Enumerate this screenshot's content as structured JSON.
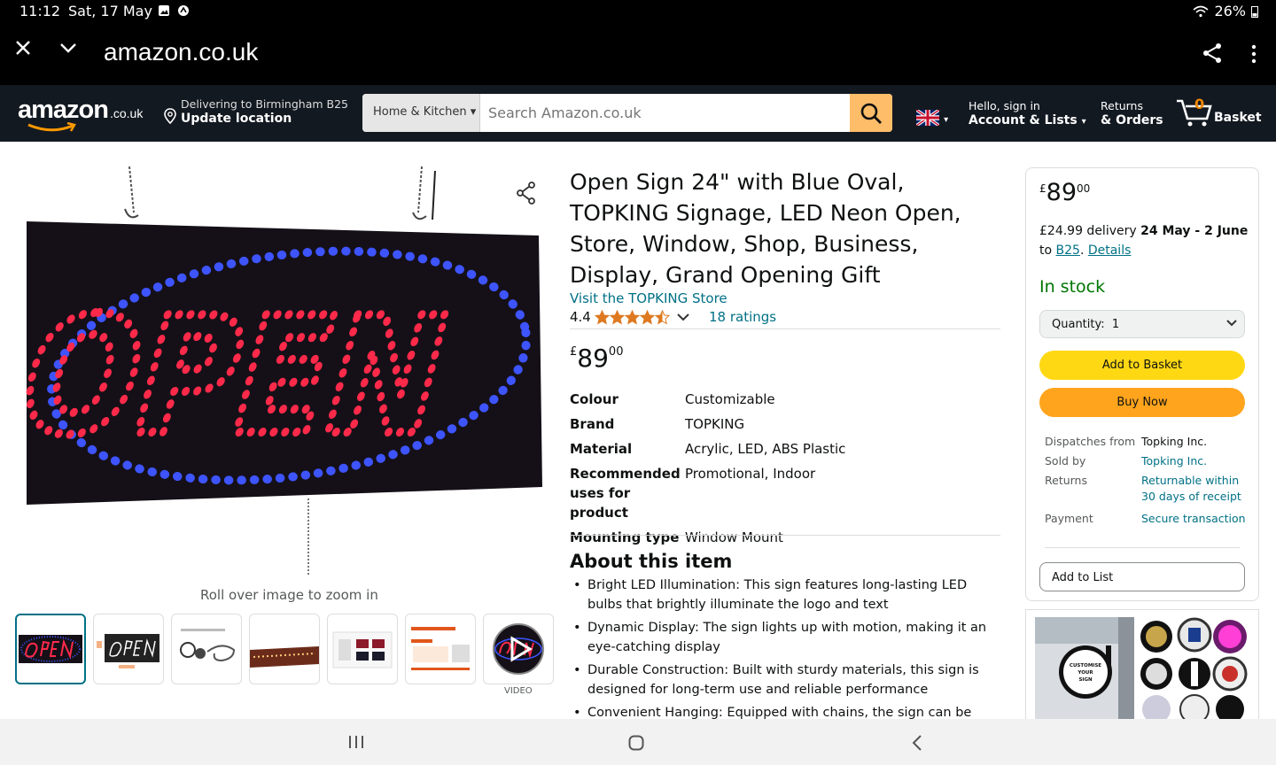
{
  "status_bar": {
    "time": "11:12",
    "date": "Sat, 17 May",
    "battery": "26%"
  },
  "browser": {
    "url": "amazon.co.uk"
  },
  "header": {
    "logo_text": "amazon",
    "logo_tld": ".co.uk",
    "delivering_to": "Delivering to Birmingham B25",
    "update_location": "Update location",
    "search_category": "Home & Kitchen",
    "search_placeholder": "Search Amazon.co.uk",
    "hello": "Hello, sign in",
    "account_lists": "Account & Lists",
    "returns": "Returns",
    "orders": "& Orders",
    "basket_count": "0",
    "basket_label": "Basket"
  },
  "product": {
    "title": "Open Sign 24\" with Blue Oval, TOPKING Signage, LED Neon Open, Store, Window, Shop, Business, Display, Grand Opening Gift",
    "store_link": "Visit the TOPKING Store",
    "rating": "4.4",
    "ratings_count": "18 ratings",
    "price_symbol": "£",
    "price_whole": "89",
    "price_fraction": "00",
    "zoom_hint": "Roll over image to zoom in",
    "video_label": "VIDEO",
    "main_image_text": "OPEN",
    "specs": [
      {
        "key": "Colour",
        "value": "Customizable"
      },
      {
        "key": "Brand",
        "value": "TOPKING"
      },
      {
        "key": "Material",
        "value": "Acrylic, LED, ABS Plastic"
      },
      {
        "key": "Recommended uses for product",
        "value": "Promotional, Indoor"
      },
      {
        "key": "Mounting type",
        "value": "Window Mount"
      }
    ],
    "about_heading": "About this item",
    "bullets": [
      "Bright LED Illumination: This sign features long-lasting LED bulbs that brightly illuminate the logo and text",
      "Dynamic Display: The sign lights up with motion, making it an eye-catching display",
      "Durable Construction: Built with sturdy materials, this sign is designed for long-term use and reliable performance",
      "Convenient Hanging: Equipped with chains, the sign can be easily"
    ]
  },
  "buybox": {
    "price_symbol": "£",
    "price_whole": "89",
    "price_fraction": "00",
    "delivery_text": "£24.99 delivery",
    "delivery_dates": "24 May - 2 June",
    "to_text": "to",
    "postcode": "B25",
    "details": "Details",
    "in_stock": "In stock",
    "quantity_label": "Quantity:",
    "quantity_value": "1",
    "add_to_basket": "Add to Basket",
    "buy_now": "Buy Now",
    "info": [
      {
        "key": "Dispatches from",
        "value": "Topking Inc."
      },
      {
        "key": "Sold by",
        "value": "Topking Inc."
      },
      {
        "key": "Returns",
        "value": "Returnable within 30 days of receipt"
      },
      {
        "key": "Payment",
        "value": "Secure transaction"
      }
    ],
    "add_to_list": "Add to List"
  },
  "ad": {
    "sign_text": "CUSTOMISE YOUR SIGN"
  },
  "colors": {
    "nav": "#131921",
    "search_button": "#febd69",
    "add_button": "#ffd814",
    "buy_button": "#ffa41c",
    "link": "#007185",
    "in_stock": "#007600",
    "star": "#de7921"
  }
}
